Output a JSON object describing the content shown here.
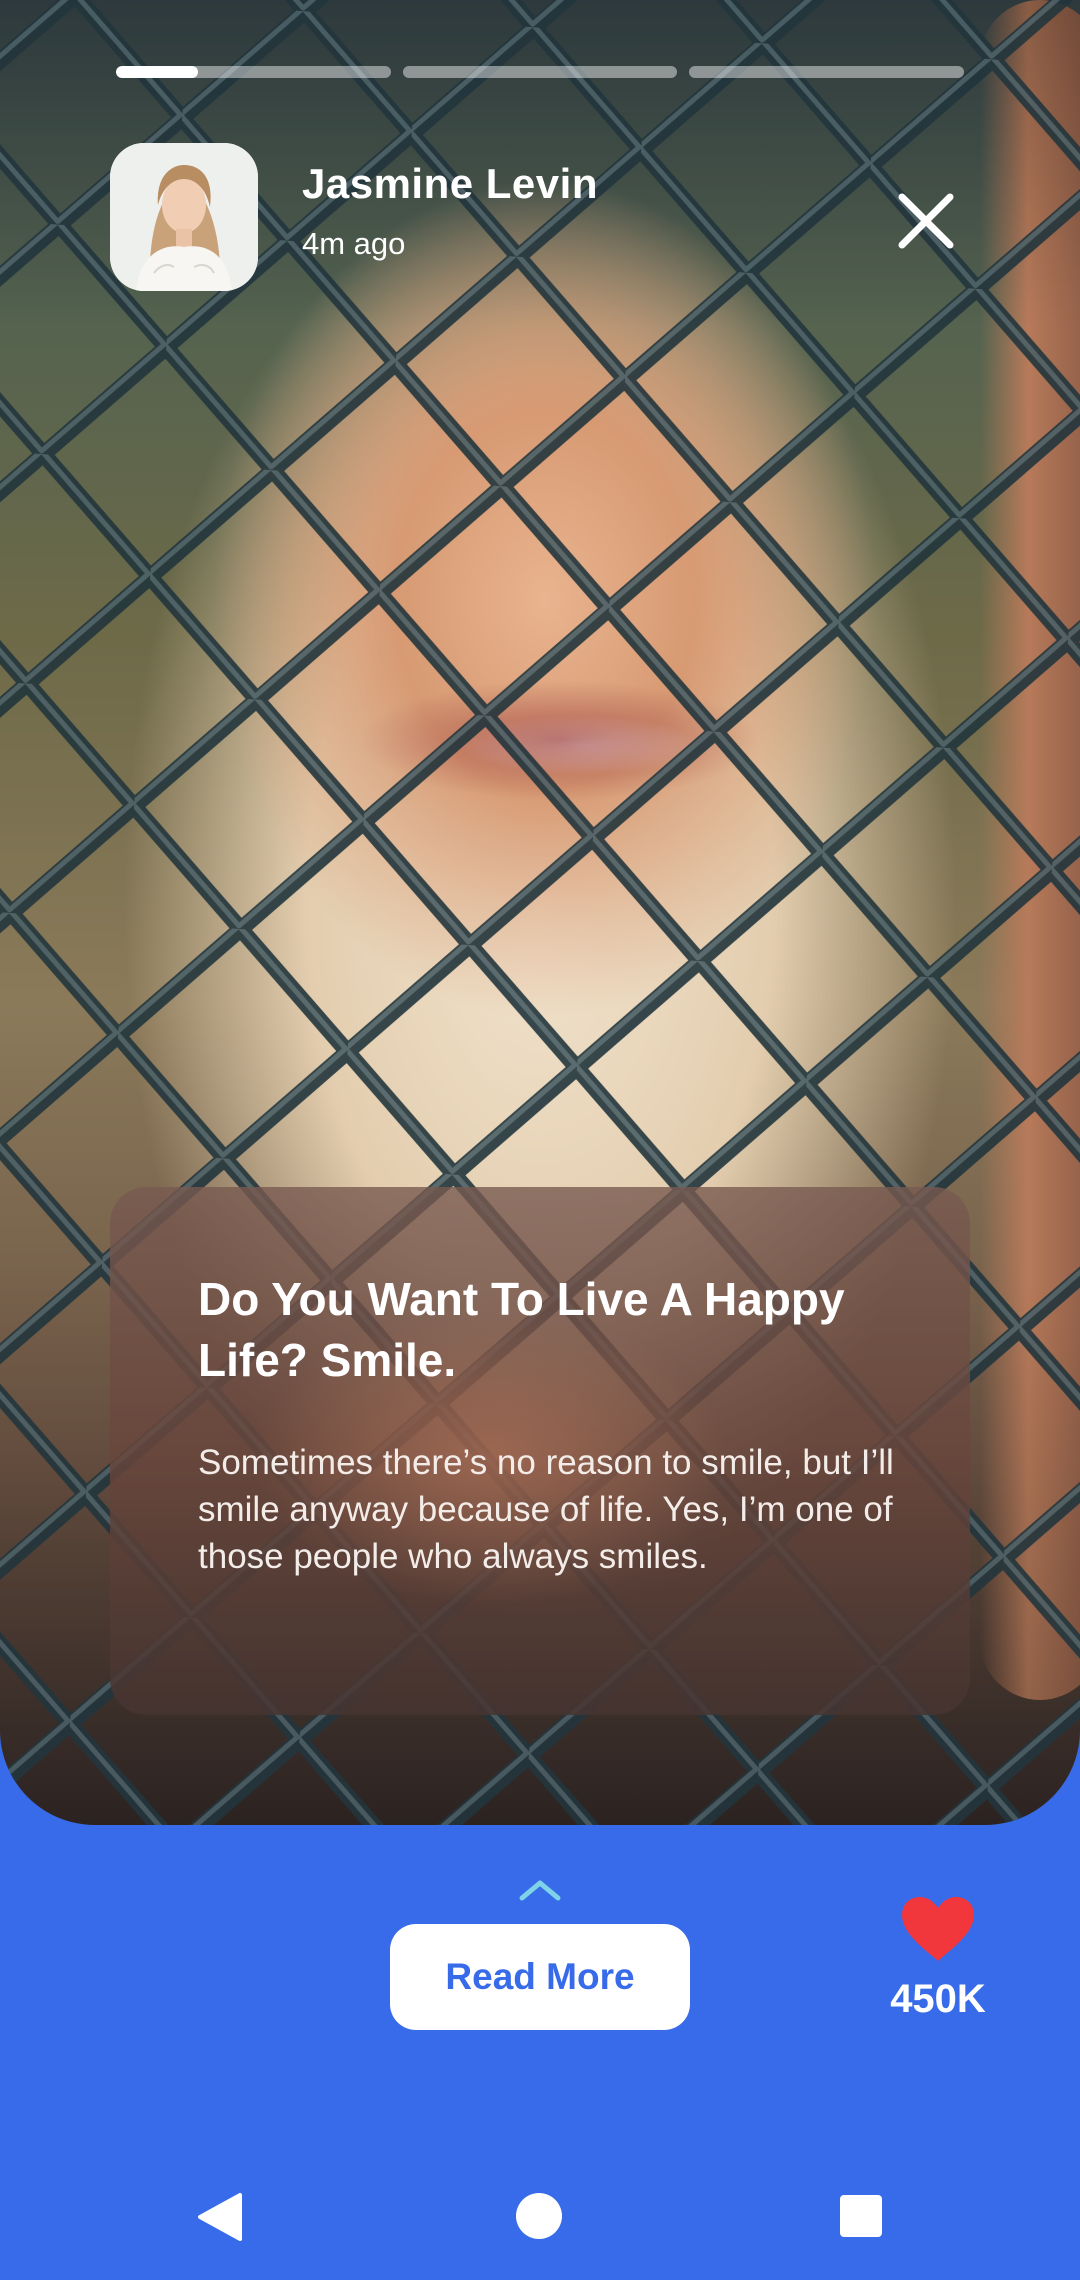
{
  "story": {
    "progress": [
      {
        "fill": 0.3
      },
      {
        "fill": 0
      },
      {
        "fill": 0
      }
    ],
    "user": {
      "name": "Jasmine Levin",
      "time": "4m ago"
    },
    "icons": {
      "close": "close-icon"
    },
    "card": {
      "title": "Do You Want To Live A Happy Life? Smile.",
      "body": "Sometimes there’s no reason to smile, but I’ll smile anyway because of life. Yes, I’m one of those people who always smiles."
    }
  },
  "actions": {
    "swipe_icon": "chevron-up-icon",
    "read_more_label": "Read More",
    "like_icon": "heart-icon",
    "like_count": "450K"
  },
  "colors": {
    "accent": "#376BEA",
    "heart": "#F1373B",
    "chevron": "#7FD3E8"
  },
  "navbar": {
    "back": "back-icon",
    "home": "home-icon",
    "recents": "recents-icon"
  }
}
